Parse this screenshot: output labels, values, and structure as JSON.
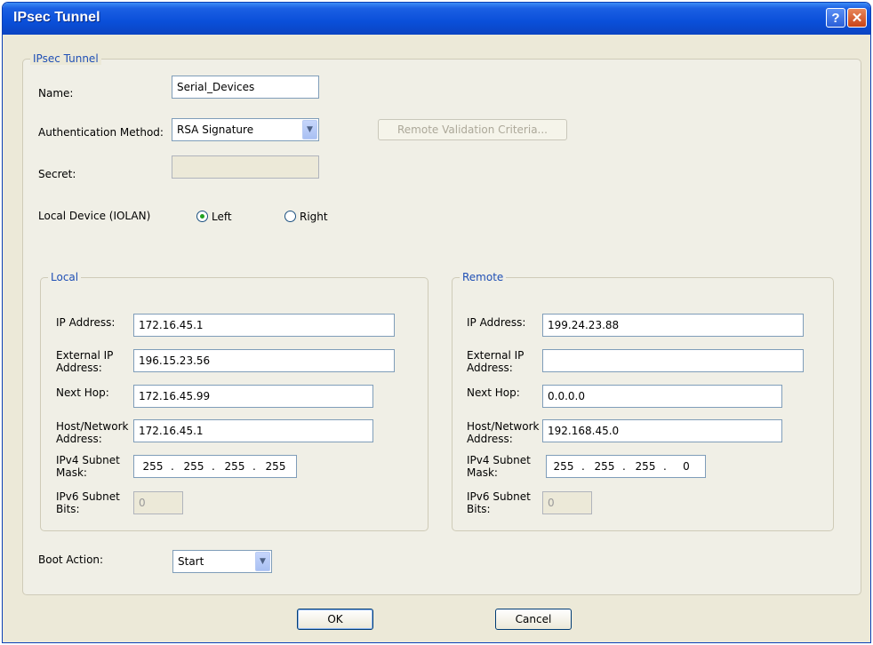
{
  "window": {
    "title": "IPsec Tunnel",
    "help_glyph": "?",
    "close_glyph": "✕"
  },
  "tunnel_group": {
    "legend": "IPsec Tunnel",
    "name_label": "Name:",
    "name_value": "Serial_Devices",
    "auth_label": "Authentication Method:",
    "auth_value": "RSA Signature",
    "remote_validation_label": "Remote Validation Criteria...",
    "secret_label": "Secret:",
    "secret_value": "",
    "local_device_label": "Local Device (IOLAN)",
    "radio_left": "Left",
    "radio_right": "Right",
    "selected_side": "Left"
  },
  "local": {
    "legend": "Local",
    "ip_label": "IP Address:",
    "ip_value": "172.16.45.1",
    "ext_ip_label_1": "External IP",
    "ext_ip_label_2": "Address:",
    "ext_ip_value": "196.15.23.56",
    "next_hop_label": "Next Hop:",
    "next_hop_value": "172.16.45.99",
    "host_net_label_1": "Host/Network",
    "host_net_label_2": "Address:",
    "host_net_value": "172.16.45.1",
    "ipv4_mask_label_1": "IPv4 Subnet",
    "ipv4_mask_label_2": "Mask:",
    "ipv4_mask": [
      "255",
      "255",
      "255",
      "255"
    ],
    "ipv6_bits_label_1": "IPv6 Subnet",
    "ipv6_bits_label_2": "Bits:",
    "ipv6_bits_value": "0"
  },
  "remote": {
    "legend": "Remote",
    "ip_label": "IP Address:",
    "ip_value": "199.24.23.88",
    "ext_ip_label_1": "External IP",
    "ext_ip_label_2": "Address:",
    "ext_ip_value": "",
    "next_hop_label": "Next Hop:",
    "next_hop_value": "0.0.0.0",
    "host_net_label_1": "Host/Network",
    "host_net_label_2": "Address:",
    "host_net_value": "192.168.45.0",
    "ipv4_mask_label_1": "IPv4 Subnet",
    "ipv4_mask_label_2": "Mask:",
    "ipv4_mask": [
      "255",
      "255",
      "255",
      "0"
    ],
    "ipv6_bits_label_1": "IPv6 Subnet",
    "ipv6_bits_label_2": "Bits:",
    "ipv6_bits_value": "0"
  },
  "boot": {
    "label": "Boot Action:",
    "value": "Start"
  },
  "footer": {
    "ok_label": "OK",
    "cancel_label": "Cancel"
  },
  "dropdown_glyph": "▼",
  "ip_separator": "."
}
